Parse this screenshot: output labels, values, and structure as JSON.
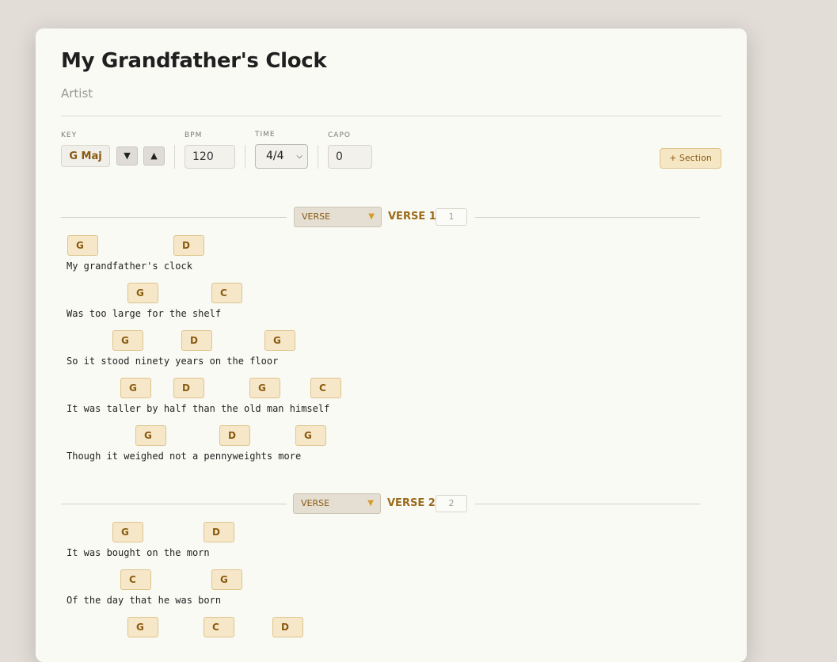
{
  "song": {
    "title": "My Grandfather's Clock",
    "artist": "Artist"
  },
  "controls": {
    "key_label": "KEY",
    "key_value": "G Maj",
    "key_down": "▼",
    "key_up": "▲",
    "bpm_label": "BPM",
    "bpm_value": "120",
    "time_label": "TIME",
    "time_value": "4/4",
    "capo_label": "CAPO",
    "capo_value": "0",
    "add_section": "+ Section"
  },
  "sections": [
    {
      "type": "VERSE",
      "name": "VERSE 1",
      "number": "1",
      "lines": [
        {
          "chords": [
            "G",
            "D"
          ],
          "lyric": "My grandfather's clock"
        },
        {
          "chords": [
            "G",
            "C"
          ],
          "lyric": "Was too large for the shelf"
        },
        {
          "chords": [
            "G",
            "D",
            "G"
          ],
          "lyric": "So it stood ninety years on the floor"
        },
        {
          "chords": [
            "G",
            "D",
            "G",
            "C"
          ],
          "lyric": "It was taller by half than the old man himself"
        },
        {
          "chords": [
            "G",
            "D",
            "G"
          ],
          "lyric": "Though it weighed not a pennyweights more"
        }
      ]
    },
    {
      "type": "VERSE",
      "name": "VERSE 2",
      "number": "2",
      "lines": [
        {
          "chords": [
            "G",
            "D"
          ],
          "lyric": "It was bought on the morn"
        },
        {
          "chords": [
            "C",
            "G"
          ],
          "lyric": "Of the day that he was born"
        },
        {
          "chords": [
            "G",
            "C",
            "D"
          ],
          "lyric": ""
        }
      ]
    }
  ]
}
